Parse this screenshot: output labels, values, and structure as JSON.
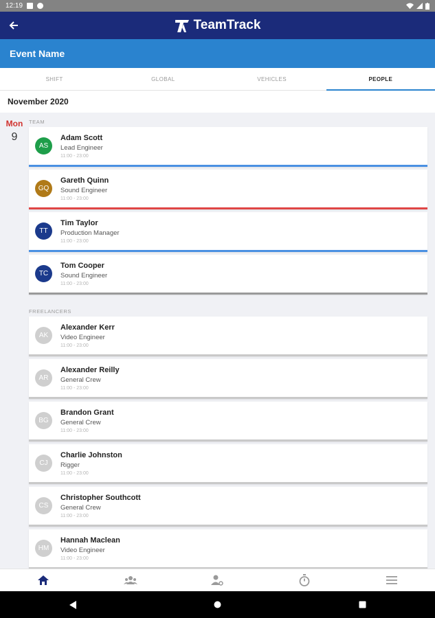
{
  "status_bar": {
    "time": "12:19"
  },
  "app_bar": {
    "back_icon": "arrow-left-icon",
    "brand_name": "TeamTrack"
  },
  "event": {
    "name": "Event Name"
  },
  "tabs": [
    {
      "label": "SHIFT"
    },
    {
      "label": "GLOBAL"
    },
    {
      "label": "VEHICLES"
    },
    {
      "label": "PEOPLE"
    }
  ],
  "active_tab": "PEOPLE",
  "month": "November 2020",
  "day": {
    "name": "Mon",
    "number": "9"
  },
  "team": {
    "label": "TEAM",
    "people": [
      {
        "initials": "AS",
        "name": "Adam Scott",
        "role": "Lead Engineer",
        "time": "11:00 - 23:00",
        "avatar_color": "#1e9e4a",
        "accent_color": "#4a90e2"
      },
      {
        "initials": "GQ",
        "name": "Gareth Quinn",
        "role": "Sound Engineer",
        "time": "11:00 - 23:00",
        "avatar_color": "#b07a18",
        "accent_color": "#e04545"
      },
      {
        "initials": "TT",
        "name": "Tim Taylor",
        "role": "Production Manager",
        "time": "11:00 - 23:00",
        "avatar_color": "#1b3a8c",
        "accent_color": "#4a90e2"
      },
      {
        "initials": "TC",
        "name": "Tom Cooper",
        "role": "Sound Engineer",
        "time": "11:00 - 23:00",
        "avatar_color": "#1b3a8c",
        "accent_color": "#9a9a9a"
      }
    ]
  },
  "freelancers": {
    "label": "FREELANCERS",
    "people": [
      {
        "initials": "AK",
        "name": "Alexander Kerr",
        "role": "Video Engineer",
        "time": "11:00 - 23:00",
        "avatar_color": "#cfcfcf",
        "accent_color": "#c9c9c9"
      },
      {
        "initials": "AR",
        "name": "Alexander Reilly",
        "role": "General Crew",
        "time": "11:00 - 23:00",
        "avatar_color": "#cfcfcf",
        "accent_color": "#c9c9c9"
      },
      {
        "initials": "BG",
        "name": "Brandon Grant",
        "role": "General Crew",
        "time": "11:00 - 23:00",
        "avatar_color": "#cfcfcf",
        "accent_color": "#c9c9c9"
      },
      {
        "initials": "CJ",
        "name": "Charlie Johnston",
        "role": "Rigger",
        "time": "11:00 - 23:00",
        "avatar_color": "#cfcfcf",
        "accent_color": "#c9c9c9"
      },
      {
        "initials": "CS",
        "name": "Christopher Southcott",
        "role": "General Crew",
        "time": "11:00 - 23:00",
        "avatar_color": "#cfcfcf",
        "accent_color": "#c9c9c9"
      },
      {
        "initials": "HM",
        "name": "Hannah Maclean",
        "role": "Video Engineer",
        "time": "11:00 - 23:00",
        "avatar_color": "#cfcfcf",
        "accent_color": "#c9c9c9"
      }
    ]
  },
  "bottom_nav": [
    {
      "icon": "home-icon",
      "active": true
    },
    {
      "icon": "team-icon",
      "active": false
    },
    {
      "icon": "person-settings-icon",
      "active": false
    },
    {
      "icon": "stopwatch-icon",
      "active": false
    },
    {
      "icon": "menu-icon",
      "active": false
    }
  ],
  "colors": {
    "primary_dark": "#1b2b7a",
    "primary": "#2a83cf",
    "day_red": "#d0312d",
    "nav_active": "#1b2b7a",
    "nav_inactive": "#9a9a9a"
  }
}
